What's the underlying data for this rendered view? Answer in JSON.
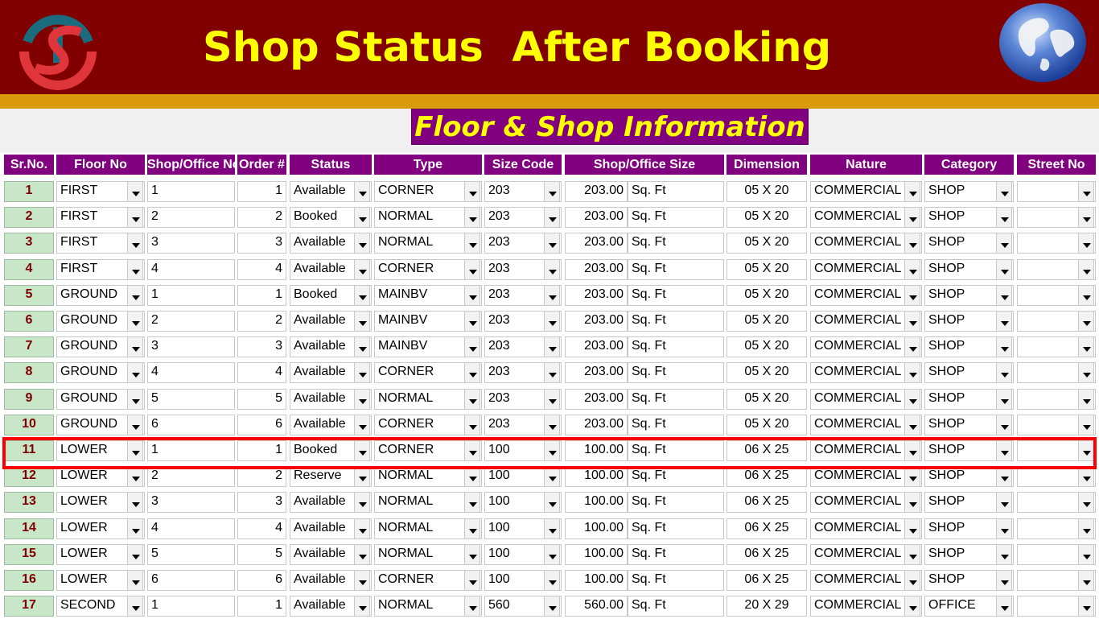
{
  "header": {
    "title": "Shop Status  After Booking"
  },
  "section": {
    "title": "Floor & Shop Information"
  },
  "columns": [
    "Sr.No.",
    "Floor No",
    "Shop/Office No",
    "Order #",
    "Status",
    "Type",
    "Size Code",
    "Shop/Office Size",
    "Dimension",
    "Nature",
    "Category",
    "Street No"
  ],
  "colors": {
    "header_bg": "#800000",
    "title": "#ffff00",
    "gold_bar": "#d99b0c",
    "col_header_bg": "#800080",
    "sr_bg": "#c8e6c8",
    "highlight": "#ff0000"
  },
  "icons": {
    "logo": "ts-logo-icon",
    "globe": "globe-icon",
    "dropdown": "chevron-down-icon"
  },
  "highlighted_sr": "11",
  "rows": [
    {
      "sr": "1",
      "floor": "FIRST",
      "shop_no": "1",
      "order": "1",
      "status": "Available",
      "type": "CORNER",
      "size_code": "203",
      "size": "203.00",
      "unit": "Sq. Ft",
      "dimension": "05 X 20",
      "nature": "COMMERCIAL",
      "category": "SHOP",
      "street": ""
    },
    {
      "sr": "2",
      "floor": "FIRST",
      "shop_no": "2",
      "order": "2",
      "status": "Booked",
      "type": "NORMAL",
      "size_code": "203",
      "size": "203.00",
      "unit": "Sq. Ft",
      "dimension": "05 X 20",
      "nature": "COMMERCIAL",
      "category": "SHOP",
      "street": ""
    },
    {
      "sr": "3",
      "floor": "FIRST",
      "shop_no": "3",
      "order": "3",
      "status": "Available",
      "type": "NORMAL",
      "size_code": "203",
      "size": "203.00",
      "unit": "Sq. Ft",
      "dimension": "05 X 20",
      "nature": "COMMERCIAL",
      "category": "SHOP",
      "street": ""
    },
    {
      "sr": "4",
      "floor": "FIRST",
      "shop_no": "4",
      "order": "4",
      "status": "Available",
      "type": "CORNER",
      "size_code": "203",
      "size": "203.00",
      "unit": "Sq. Ft",
      "dimension": "05 X 20",
      "nature": "COMMERCIAL",
      "category": "SHOP",
      "street": ""
    },
    {
      "sr": "5",
      "floor": "GROUND",
      "shop_no": "1",
      "order": "1",
      "status": "Booked",
      "type": "MAINBV",
      "size_code": "203",
      "size": "203.00",
      "unit": "Sq. Ft",
      "dimension": "05 X 20",
      "nature": "COMMERCIAL",
      "category": "SHOP",
      "street": ""
    },
    {
      "sr": "6",
      "floor": "GROUND",
      "shop_no": "2",
      "order": "2",
      "status": "Available",
      "type": "MAINBV",
      "size_code": "203",
      "size": "203.00",
      "unit": "Sq. Ft",
      "dimension": "05 X 20",
      "nature": "COMMERCIAL",
      "category": "SHOP",
      "street": ""
    },
    {
      "sr": "7",
      "floor": "GROUND",
      "shop_no": "3",
      "order": "3",
      "status": "Available",
      "type": "MAINBV",
      "size_code": "203",
      "size": "203.00",
      "unit": "Sq. Ft",
      "dimension": "05 X 20",
      "nature": "COMMERCIAL",
      "category": "SHOP",
      "street": ""
    },
    {
      "sr": "8",
      "floor": "GROUND",
      "shop_no": "4",
      "order": "4",
      "status": "Available",
      "type": "CORNER",
      "size_code": "203",
      "size": "203.00",
      "unit": "Sq. Ft",
      "dimension": "05 X 20",
      "nature": "COMMERCIAL",
      "category": "SHOP",
      "street": ""
    },
    {
      "sr": "9",
      "floor": "GROUND",
      "shop_no": "5",
      "order": "5",
      "status": "Available",
      "type": "NORMAL",
      "size_code": "203",
      "size": "203.00",
      "unit": "Sq. Ft",
      "dimension": "05 X 20",
      "nature": "COMMERCIAL",
      "category": "SHOP",
      "street": ""
    },
    {
      "sr": "10",
      "floor": "GROUND",
      "shop_no": "6",
      "order": "6",
      "status": "Available",
      "type": "CORNER",
      "size_code": "203",
      "size": "203.00",
      "unit": "Sq. Ft",
      "dimension": "05 X 20",
      "nature": "COMMERCIAL",
      "category": "SHOP",
      "street": ""
    },
    {
      "sr": "11",
      "floor": "LOWER",
      "shop_no": "1",
      "order": "1",
      "status": "Booked",
      "type": "CORNER",
      "size_code": "100",
      "size": "100.00",
      "unit": "Sq. Ft",
      "dimension": "06 X 25",
      "nature": "COMMERCIAL",
      "category": "SHOP",
      "street": ""
    },
    {
      "sr": "12",
      "floor": "LOWER",
      "shop_no": "2",
      "order": "2",
      "status": "Reserve",
      "type": "NORMAL",
      "size_code": "100",
      "size": "100.00",
      "unit": "Sq. Ft",
      "dimension": "06 X 25",
      "nature": "COMMERCIAL",
      "category": "SHOP",
      "street": ""
    },
    {
      "sr": "13",
      "floor": "LOWER",
      "shop_no": "3",
      "order": "3",
      "status": "Available",
      "type": "NORMAL",
      "size_code": "100",
      "size": "100.00",
      "unit": "Sq. Ft",
      "dimension": "06 X 25",
      "nature": "COMMERCIAL",
      "category": "SHOP",
      "street": ""
    },
    {
      "sr": "14",
      "floor": "LOWER",
      "shop_no": "4",
      "order": "4",
      "status": "Available",
      "type": "NORMAL",
      "size_code": "100",
      "size": "100.00",
      "unit": "Sq. Ft",
      "dimension": "06 X 25",
      "nature": "COMMERCIAL",
      "category": "SHOP",
      "street": ""
    },
    {
      "sr": "15",
      "floor": "LOWER",
      "shop_no": "5",
      "order": "5",
      "status": "Available",
      "type": "NORMAL",
      "size_code": "100",
      "size": "100.00",
      "unit": "Sq. Ft",
      "dimension": "06 X 25",
      "nature": "COMMERCIAL",
      "category": "SHOP",
      "street": ""
    },
    {
      "sr": "16",
      "floor": "LOWER",
      "shop_no": "6",
      "order": "6",
      "status": "Available",
      "type": "CORNER",
      "size_code": "100",
      "size": "100.00",
      "unit": "Sq. Ft",
      "dimension": "06 X 25",
      "nature": "COMMERCIAL",
      "category": "SHOP",
      "street": ""
    },
    {
      "sr": "17",
      "floor": "SECOND",
      "shop_no": "1",
      "order": "1",
      "status": "Available",
      "type": "NORMAL",
      "size_code": "560",
      "size": "560.00",
      "unit": "Sq. Ft",
      "dimension": "20 X 29",
      "nature": "COMMERCIAL",
      "category": "OFFICE",
      "street": ""
    }
  ]
}
